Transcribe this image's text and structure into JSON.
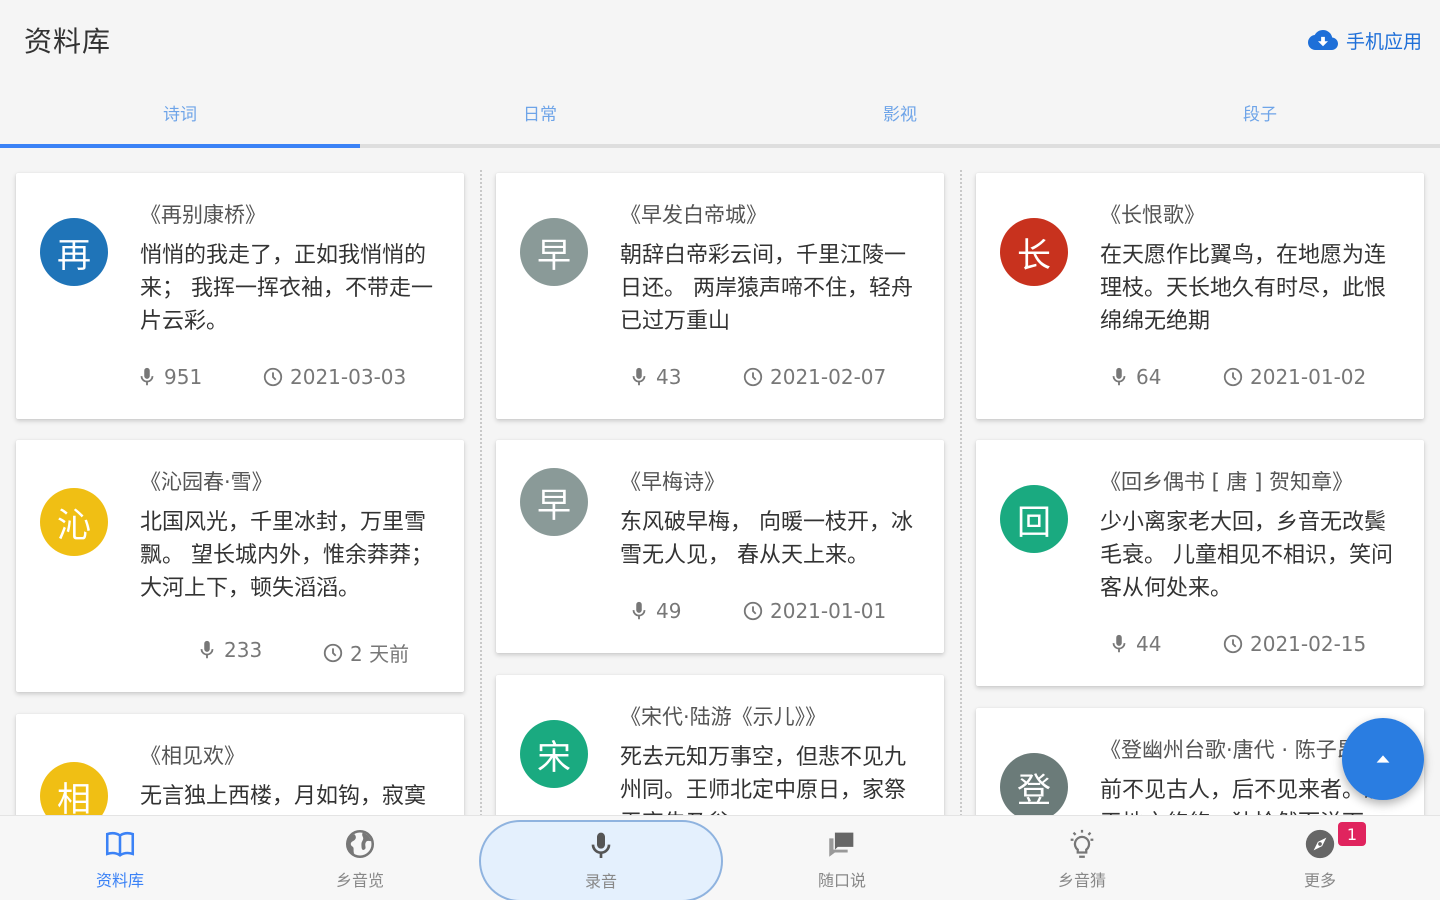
{
  "header": {
    "title": "资料库",
    "app_link": "手机应用"
  },
  "tabs": [
    {
      "label": "诗词",
      "active": true
    },
    {
      "label": "日常",
      "active": false
    },
    {
      "label": "影视",
      "active": false
    },
    {
      "label": "段子",
      "active": false
    }
  ],
  "cards": [
    {
      "avatar": "再",
      "color": "#1f74b8",
      "title": "《再别康桥》",
      "text": "悄悄的我走了，正如我悄悄的来； 我挥一挥衣袖，不带走一片云彩。",
      "plays": "951",
      "date": "2021-03-03"
    },
    {
      "avatar": "沁",
      "color": "#f0bf14",
      "title": "《沁园春·雪》",
      "text": "北国风光，千里冰封，万里雪飘。 望长城内外，惟余莽莽；大河上下，顿失滔滔。",
      "plays": "233",
      "date": "2 天前"
    },
    {
      "avatar": "相",
      "color": "#f0bf14",
      "title": "《相见欢》",
      "text": "无言独上西楼，月如钩，寂寞梧桐深院锁清秋。",
      "plays": "",
      "date": ""
    },
    {
      "avatar": "早",
      "color": "#8a9a98",
      "title": "《早发白帝城》",
      "text": "朝辞白帝彩云间，千里江陵一日还。 两岸猿声啼不住，轻舟已过万重山",
      "plays": "43",
      "date": "2021-02-07"
    },
    {
      "avatar": "早",
      "color": "#8a9a98",
      "title": "《早梅诗》",
      "text": "东风破早梅， 向暖一枝开，冰雪无人见， 春从天上来。",
      "plays": "49",
      "date": "2021-01-01"
    },
    {
      "avatar": "宋",
      "color": "#1aaa80",
      "title": "《宋代·陆游《示儿》》",
      "text": "死去元知万事空，但悲不见九州同。王师北定中原日，家祭无忘告乃翁。",
      "plays": "",
      "date": ""
    },
    {
      "avatar": "长",
      "color": "#c8321e",
      "title": "《长恨歌》",
      "text": "在天愿作比翼鸟，在地愿为连理枝。天长地久有时尽，此恨绵绵无绝期",
      "plays": "64",
      "date": "2021-01-02"
    },
    {
      "avatar": "回",
      "color": "#1aaa80",
      "title": "《回乡偶书 [ 唐 ] 贺知章》",
      "text": "少小离家老大回，乡音无改鬓毛衰。 儿童相见不相识，笑问客从何处来。",
      "plays": "44",
      "date": "2021-02-15"
    },
    {
      "avatar": "登",
      "color": "#6b7b79",
      "title": "《登幽州台歌·唐代 · 陈子昂》",
      "text": "前不见古人，后不见来者。念天地之悠悠，独怆然而涕下。",
      "plays": "",
      "date": ""
    }
  ],
  "nav": [
    {
      "label": "资料库",
      "icon": "book-icon",
      "active": true
    },
    {
      "label": "乡音览",
      "icon": "globe-icon",
      "active": false
    },
    {
      "label": "录音",
      "icon": "mic-icon",
      "active": false
    },
    {
      "label": "随口说",
      "icon": "chat-icon",
      "active": false
    },
    {
      "label": "乡音猜",
      "icon": "lightbulb-icon",
      "active": false
    },
    {
      "label": "更多",
      "icon": "compass-icon",
      "active": false
    }
  ],
  "badge": "1",
  "colors": {
    "accent": "#3b82f6",
    "link": "#1e6fd8",
    "fab": "#2a7de1",
    "badge": "#e0245e"
  }
}
